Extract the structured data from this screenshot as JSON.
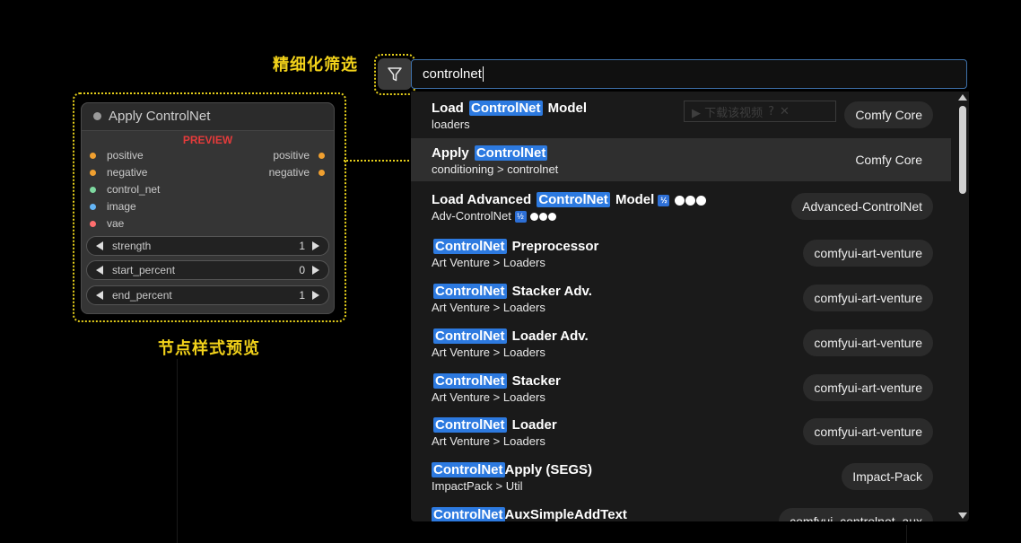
{
  "annotations": {
    "filter_label": "精细化筛选",
    "preview_label": "节点样式预览"
  },
  "search": {
    "value": "controlnet"
  },
  "watermark": {
    "text": "▶ 下载该视频",
    "q": "?",
    "x": "✕"
  },
  "results": [
    {
      "pre": "Load ",
      "hl": "ControlNet",
      "post": " Model",
      "sub": "loaders",
      "badge": "Comfy Core"
    },
    {
      "pre": "Apply ",
      "hl": "ControlNet",
      "post": "",
      "sub": "conditioning > controlnet",
      "badge": "Comfy Core",
      "selected": true
    },
    {
      "pre": "Load Advanced ",
      "hl": "ControlNet",
      "post": " Model",
      "sub": "Adv-ControlNet",
      "badge": "Advanced-ControlNet",
      "emoji": "🛂",
      "emoji_glyph": "½"
    },
    {
      "pre": "",
      "hl": "ControlNet",
      "post": " Preprocessor",
      "sub": "Art Venture > Loaders",
      "badge": "comfyui-art-venture"
    },
    {
      "pre": "",
      "hl": "ControlNet",
      "post": " Stacker Adv.",
      "sub": "Art Venture > Loaders",
      "badge": "comfyui-art-venture"
    },
    {
      "pre": "",
      "hl": "ControlNet",
      "post": " Loader Adv.",
      "sub": "Art Venture > Loaders",
      "badge": "comfyui-art-venture"
    },
    {
      "pre": "",
      "hl": "ControlNet",
      "post": " Stacker",
      "sub": "Art Venture > Loaders",
      "badge": "comfyui-art-venture"
    },
    {
      "pre": "",
      "hl": "ControlNet",
      "post": " Loader",
      "sub": "Art Venture > Loaders",
      "badge": "comfyui-art-venture"
    },
    {
      "pre": "",
      "hl": "ControlNet",
      "post": "Apply (SEGS)",
      "sub": "ImpactPack > Util",
      "badge": "Impact-Pack",
      "tight": true
    },
    {
      "pre": "",
      "hl": "ControlNet",
      "post": "AuxSimpleAddText",
      "sub": "",
      "badge": "comfyui_controlnet_aux",
      "tight": true
    }
  ],
  "node": {
    "title": "Apply ControlNet",
    "preview": "PREVIEW",
    "inputs": [
      {
        "name": "positive",
        "color": "#f0a030"
      },
      {
        "name": "negative",
        "color": "#f0a030"
      },
      {
        "name": "control_net",
        "color": "#7ed9a0"
      },
      {
        "name": "image",
        "color": "#64b5f6"
      },
      {
        "name": "vae",
        "color": "#ff6e6e"
      }
    ],
    "outputs": [
      {
        "name": "positive",
        "color": "#f0a030"
      },
      {
        "name": "negative",
        "color": "#f0a030"
      }
    ],
    "widgets": [
      {
        "name": "strength",
        "value": "1"
      },
      {
        "name": "start_percent",
        "value": "0"
      },
      {
        "name": "end_percent",
        "value": "1"
      }
    ]
  }
}
